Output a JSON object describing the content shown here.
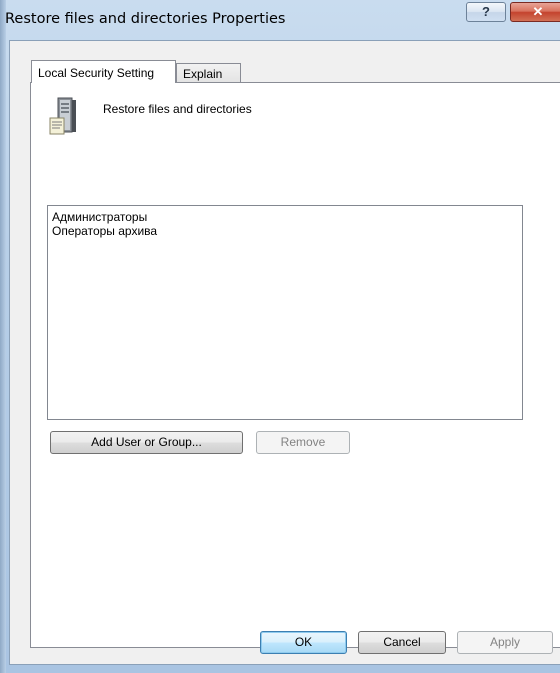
{
  "window": {
    "title": "Restore files and directories Properties",
    "help_glyph": "?",
    "close_glyph": "✕"
  },
  "tabs": [
    {
      "label": "Local Security Setting",
      "active": true
    },
    {
      "label": "Explain",
      "active": false
    }
  ],
  "policy": {
    "name": "Restore files and directories",
    "icon": "server-policy-icon"
  },
  "principals": [
    "Администраторы",
    "Операторы архива"
  ],
  "buttons": {
    "add": "Add User or Group...",
    "remove": "Remove",
    "ok": "OK",
    "cancel": "Cancel",
    "apply": "Apply"
  },
  "colors": {
    "title_bar": "#b7cfe8",
    "close": "#c4432e",
    "default_button_border": "#3c7fb1"
  }
}
